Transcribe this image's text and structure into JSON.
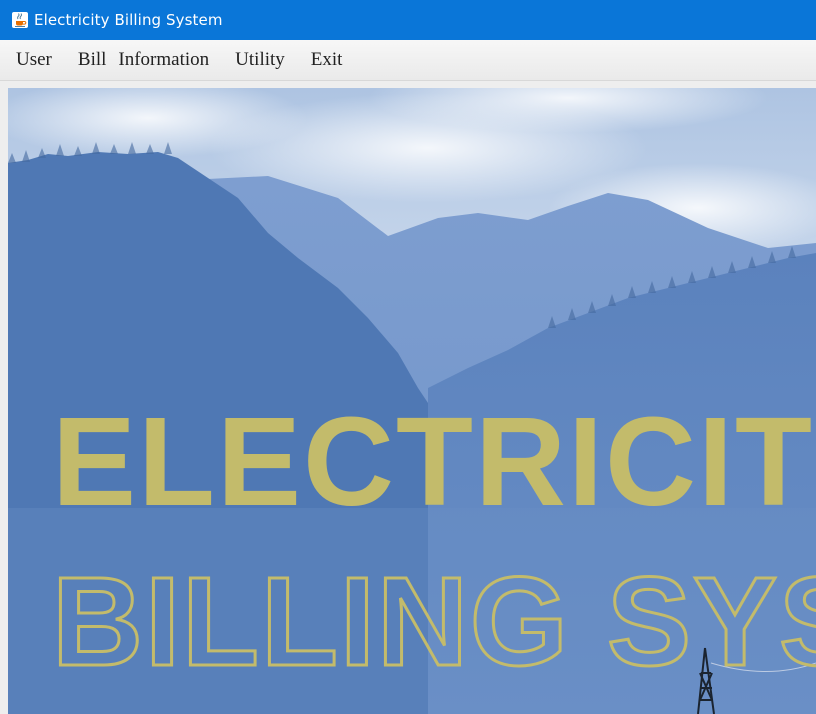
{
  "window": {
    "title": "Electricity Billing System",
    "icon": "java-cup-icon"
  },
  "menu": {
    "items": [
      "User",
      "Bill",
      "Information",
      "Utility",
      "Exit"
    ]
  },
  "background": {
    "banner_line1": "ELECTRICITY",
    "banner_line2": "BILLING SYSTEM",
    "banner_color": "#c3bb6b",
    "sky_color": "#c9d8ec",
    "mountain_color": "#5f86bd"
  }
}
